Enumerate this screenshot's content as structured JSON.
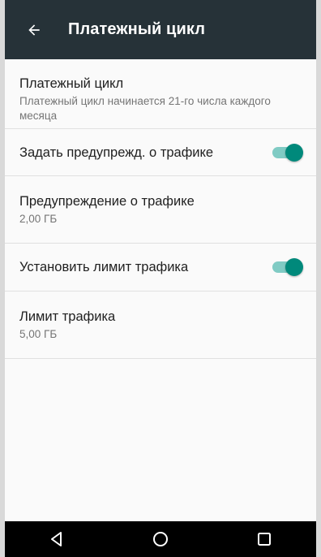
{
  "app_bar": {
    "title": "Платежный цикл",
    "back_icon": "arrow-back-icon"
  },
  "items": [
    {
      "title": "Платежный цикл",
      "summary": "Платежный цикл начинается 21-го числа каждого месяца"
    },
    {
      "title": "Задать предупрежд. о трафике",
      "toggle_on": true
    },
    {
      "title": "Предупреждение о трафике",
      "summary": "2,00 ГБ"
    },
    {
      "title": "Установить лимит трафика",
      "toggle_on": true
    },
    {
      "title": "Лимит трафика",
      "summary": "5,00 ГБ"
    }
  ],
  "nav_bar": {
    "back": "nav-back-icon",
    "home": "nav-home-icon",
    "recents": "nav-recents-icon"
  },
  "colors": {
    "app_bar": "#263238",
    "accent": "#00897b",
    "accent_track": "#80cbc4"
  }
}
